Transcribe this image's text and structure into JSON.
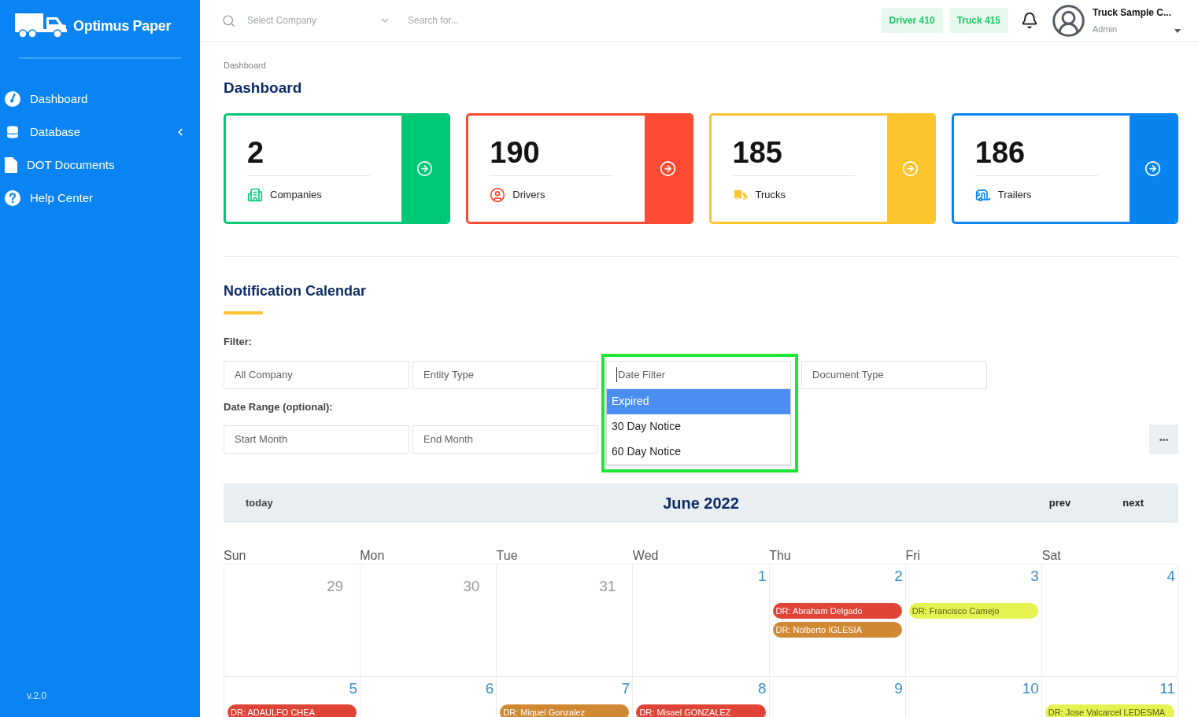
{
  "sidebar": {
    "logo_text": "Optimus Paper",
    "items": [
      {
        "label": "Dashboard",
        "expandable": false
      },
      {
        "label": "Database",
        "expandable": true
      },
      {
        "label": "DOT Documents",
        "expandable": false
      },
      {
        "label": "Help Center",
        "expandable": false
      }
    ],
    "version": "v.2.0"
  },
  "header": {
    "company_select": {
      "placeholder": "Select Company"
    },
    "search": {
      "placeholder": "Search for..."
    },
    "badges": [
      "Driver 410",
      "Truck 415"
    ],
    "user": {
      "name": "Truck Sample C...",
      "role": "Admin"
    }
  },
  "breadcrumb": "Dashboard",
  "page_title": "Dashboard",
  "stats": [
    {
      "value": "2",
      "label": "Companies",
      "color": "#00c875"
    },
    {
      "value": "190",
      "label": "Drivers",
      "color": "#ff4b33"
    },
    {
      "value": "185",
      "label": "Trucks",
      "color": "#fdc52b"
    },
    {
      "value": "186",
      "label": "Trailers",
      "color": "#0784f0"
    }
  ],
  "calendar_section": {
    "title": "Notification Calendar",
    "filter_label": "Filter:",
    "filters": [
      {
        "placeholder": "All Company"
      },
      {
        "placeholder": "Entity Type"
      },
      {
        "placeholder": "Date Filter",
        "open": true
      },
      {
        "placeholder": "Document Type"
      }
    ],
    "date_filter_options": [
      {
        "label": "Expired",
        "selected": true
      },
      {
        "label": "30 Day Notice",
        "selected": false
      },
      {
        "label": "60 Day Notice",
        "selected": false
      }
    ],
    "date_range_label": "Date Range (optional):",
    "date_range": [
      {
        "placeholder": "Start Month"
      },
      {
        "placeholder": "End Month"
      }
    ],
    "more_button": "•••"
  },
  "calendar": {
    "today_button": "today",
    "title": "June 2022",
    "prev_button": "prev",
    "next_button": "next",
    "weekdays": [
      "Sun",
      "Mon",
      "Tue",
      "Wed",
      "Thu",
      "Fri",
      "Sat"
    ],
    "weeks": [
      {
        "days": [
          {
            "number": "29",
            "muted": true
          },
          {
            "number": "30",
            "muted": true
          },
          {
            "number": "31",
            "muted": true
          },
          {
            "number": "1",
            "muted": false
          },
          {
            "number": "2",
            "muted": false,
            "events": [
              {
                "label": "DR: Abraham Delgado",
                "color": "#e04436"
              },
              {
                "label": "DR: Nolberto IGLESIA",
                "color": "#d08832"
              }
            ]
          },
          {
            "number": "3",
            "muted": false,
            "events": [
              {
                "label": "DR: Francisco Camejo",
                "color": "#e6f152"
              }
            ]
          },
          {
            "number": "4",
            "muted": false
          }
        ]
      },
      {
        "days": [
          {
            "number": "5",
            "muted": false,
            "events": [
              {
                "label": "DR: ADAULFO CHEA",
                "color": "#e04436"
              }
            ]
          },
          {
            "number": "6",
            "muted": false
          },
          {
            "number": "7",
            "muted": false,
            "events": [
              {
                "label": "DR: Miquel Gonzalez",
                "color": "#d08832"
              }
            ]
          },
          {
            "number": "8",
            "muted": false,
            "events": [
              {
                "label": "DR: Misael GONZALEZ",
                "color": "#e04436"
              }
            ]
          },
          {
            "number": "9",
            "muted": false
          },
          {
            "number": "10",
            "muted": false
          },
          {
            "number": "11",
            "muted": false,
            "events": [
              {
                "label": "DR: Jose Valcarcel LEDESMA",
                "color": "#e6f152"
              }
            ]
          }
        ]
      }
    ]
  }
}
